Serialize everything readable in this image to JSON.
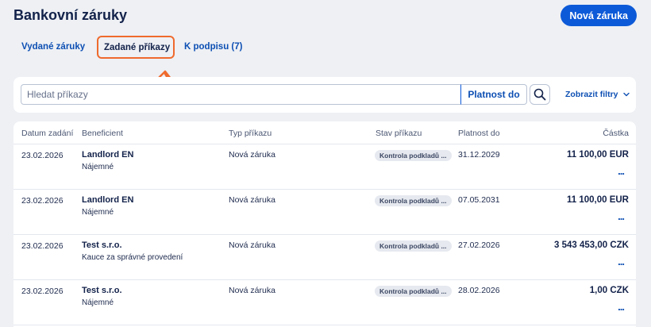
{
  "header": {
    "title": "Bankovní záruky",
    "new_button": "Nová záruka"
  },
  "tabs": [
    {
      "label": "Vydané záruky"
    },
    {
      "label": "Zadané příkazy"
    },
    {
      "label": "K podpisu (7)"
    }
  ],
  "filters": {
    "search_placeholder": "Hledat příkazy",
    "validity_label": "Platnost do",
    "show_filters_label": "Zobrazit filtry"
  },
  "table": {
    "columns": [
      "Datum zadání",
      "Beneficient",
      "Typ příkazu",
      "Stav příkazu",
      "Platnost do",
      "Částka"
    ],
    "rows": [
      {
        "date": "23.02.2026",
        "beneficiary": "Landlord EN",
        "purpose": "Nájemné",
        "type": "Nová záruka",
        "status": "Kontrola podkladů ...",
        "valid_until": "31.12.2029",
        "amount": "11 100,00 EUR",
        "more": "..."
      },
      {
        "date": "23.02.2026",
        "beneficiary": "Landlord EN",
        "purpose": "Nájemné",
        "type": "Nová záruka",
        "status": "Kontrola podkladů ...",
        "valid_until": "07.05.2031",
        "amount": "11 100,00 EUR",
        "more": "..."
      },
      {
        "date": "23.02.2026",
        "beneficiary": "Test s.r.o.",
        "purpose": "Kauce za správné provedení",
        "type": "Nová záruka",
        "status": "Kontrola podkladů ...",
        "valid_until": "27.02.2026",
        "amount": "3 543 453,00 CZK",
        "more": "..."
      },
      {
        "date": "23.02.2026",
        "beneficiary": "Test s.r.o.",
        "purpose": "Nájemné",
        "type": "Nová záruka",
        "status": "Kontrola podkladů ...",
        "valid_until": "28.02.2026",
        "amount": "1,00 CZK",
        "more": "..."
      }
    ]
  },
  "colors": {
    "accent": "#0d5ad8",
    "highlight": "#ef6a2d",
    "background": "#eef0f4"
  },
  "icons": {
    "search": "search-icon",
    "chevron": "chevron-down-icon",
    "annotation": "curved-arrow-icon"
  }
}
